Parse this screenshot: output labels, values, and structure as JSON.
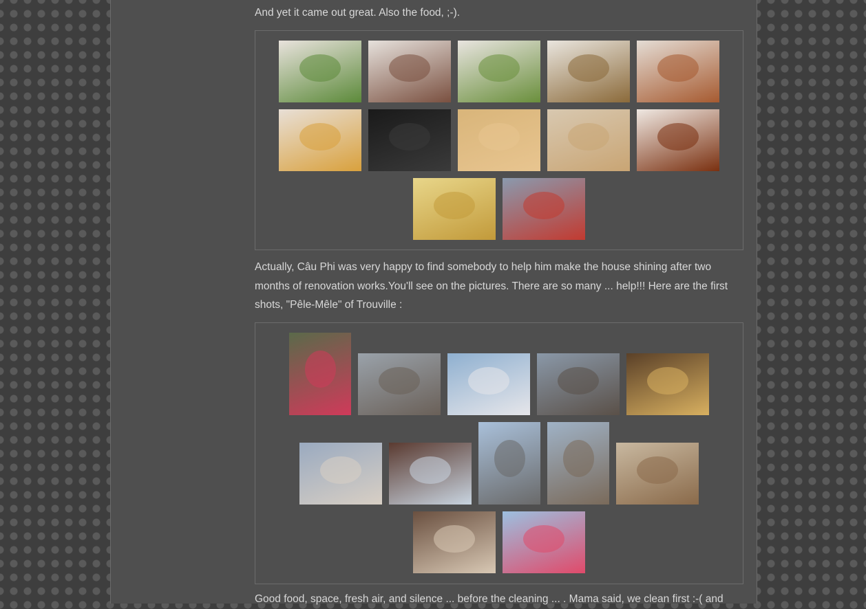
{
  "post": {
    "para1": "And yet it came out great. Also the food, ;-).",
    "para2": "Actually, Câu Phi was very happy to find somebody to help him make the house shining after two months of renovation works.You'll see on the pictures. There are so many ... help!!! Here are the first shots, \"Pêle-Mêle\" of Trouville :",
    "para3": "Good food, space, fresh air, and silence ... before the cleaning ... . Mama said, we clean first :-( and"
  },
  "gallery1": {
    "photos": [
      {
        "subject": "salad-plate",
        "base": "#e8e2dc",
        "accent": "#5c8a3a"
      },
      {
        "subject": "terrine-plate",
        "base": "#e6e1dc",
        "accent": "#7a5040"
      },
      {
        "subject": "salad-plate",
        "base": "#e8e4df",
        "accent": "#6a8f3c"
      },
      {
        "subject": "soup-cup",
        "base": "#e9e5de",
        "accent": "#8b6a3a"
      },
      {
        "subject": "fish-plate",
        "base": "#e4dcd4",
        "accent": "#a65a30"
      },
      {
        "subject": "steak-fries-plate",
        "base": "#e8dfd6",
        "accent": "#d9a13d"
      },
      {
        "subject": "mussels-pot",
        "base": "#1a1a1a",
        "accent": "#3a3a3a"
      },
      {
        "subject": "pizza",
        "base": "#d9b57a",
        "accent": "#e8c590"
      },
      {
        "subject": "crepe",
        "base": "#d8c8b0",
        "accent": "#c9a574"
      },
      {
        "subject": "flan-caramel",
        "base": "#efe8e2",
        "accent": "#7a3010"
      },
      {
        "subject": "baked-apple-dessert",
        "base": "#e8d68a",
        "accent": "#c29a3a"
      },
      {
        "subject": "restaurant-street",
        "base": "#8a9aae",
        "accent": "#c23a30"
      }
    ]
  },
  "gallery2": {
    "photos": [
      {
        "subject": "ladybug-flower-shop",
        "base": "#5a6a4a",
        "accent": "#d03a5a"
      },
      {
        "subject": "town-street",
        "base": "#9aa2aa",
        "accent": "#6a6058"
      },
      {
        "subject": "trouville-facade",
        "base": "#8fb0d0",
        "accent": "#e6e6ea"
      },
      {
        "subject": "shopping-street",
        "base": "#8a98a8",
        "accent": "#5a5048"
      },
      {
        "subject": "grocery-shelves",
        "base": "#5a4028",
        "accent": "#d8b060"
      },
      {
        "subject": "street-houses",
        "base": "#9aaac0",
        "accent": "#d8cfc4"
      },
      {
        "subject": "framed-poster",
        "base": "#5a3a30",
        "accent": "#c8d4e0"
      },
      {
        "subject": "corner-building",
        "base": "#a9c0da",
        "accent": "#6a6a6a"
      },
      {
        "subject": "narrow-street",
        "base": "#9fb2c6",
        "accent": "#7a6a5a"
      },
      {
        "subject": "mushroom-display",
        "base": "#c8b8a0",
        "accent": "#8a6a4a"
      },
      {
        "subject": "mushroom-closeup",
        "base": "#6a5040",
        "accent": "#d8c8b4"
      },
      {
        "subject": "ice-cream-sign",
        "base": "#9cc0e0",
        "accent": "#e04a6a"
      }
    ]
  }
}
